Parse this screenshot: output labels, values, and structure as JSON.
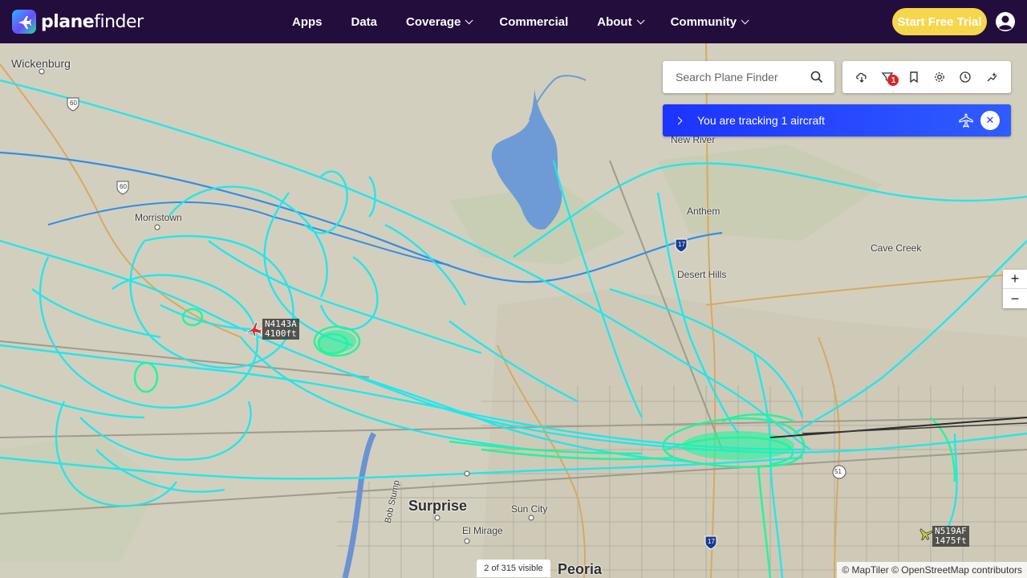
{
  "nav": {
    "brand_bold": "plane",
    "brand_light": "finder",
    "menu": [
      {
        "label": "Apps"
      },
      {
        "label": "Data"
      },
      {
        "label": "Coverage"
      },
      {
        "label": "Commercial"
      },
      {
        "label": "About"
      },
      {
        "label": "Community"
      }
    ],
    "trial_label": "Start Free Trial"
  },
  "search": {
    "placeholder": "Search Plane Finder"
  },
  "toolbar": {
    "filter_badge": "1"
  },
  "tracking": {
    "text": "You are tracking 1 aircraft",
    "close": "✕"
  },
  "zoom": {
    "in": "+",
    "out": "−"
  },
  "places": {
    "wickenburg": "Wickenburg",
    "morristown": "Morristown",
    "new_river": "New River",
    "anthem": "Anthem",
    "cave_creek": "Cave Creek",
    "desert_hills": "Desert Hills",
    "surprise": "Surprise",
    "sun_city": "Sun City",
    "el_mirage": "El Mirage",
    "peoria": "Peoria",
    "bob_stump": "Bob Stump",
    "hwy60a": "60",
    "hwy60b": "60",
    "i17a": "17",
    "i17b": "17",
    "rt51": "51"
  },
  "aircraft": [
    {
      "callsign": "N4143A",
      "altitude": "4100ft",
      "color": "#d32f2f"
    },
    {
      "callsign": "N519AF",
      "altitude": "1475ft",
      "color": "#c7d13a"
    }
  ],
  "footer": {
    "visible_count": "2 of 315 visible",
    "attribution": "© MapTiler © OpenStreetMap contributors"
  },
  "colors": {
    "nav_bg": "#230d3c",
    "trial": "#f6d64b",
    "track": "#1d33ff",
    "trail_cyan": "#19e8f0",
    "trail_green": "#1ff59e",
    "lake": "#6e9bd6"
  }
}
